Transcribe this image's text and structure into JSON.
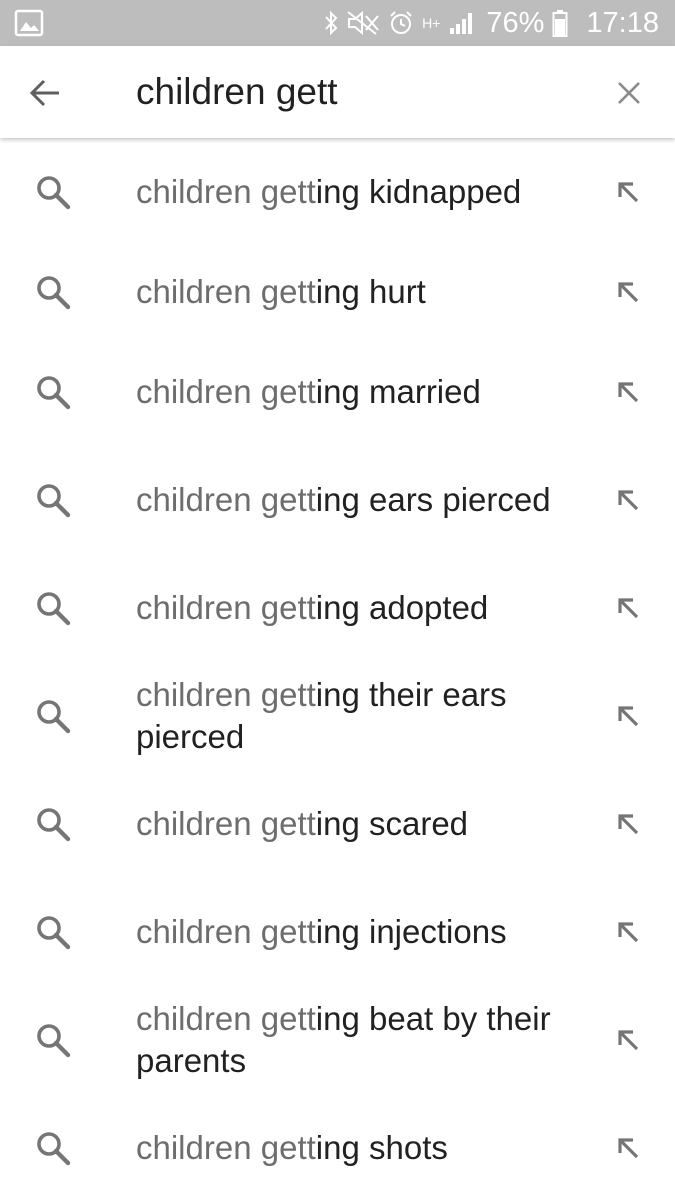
{
  "status_bar": {
    "icons": [
      "gallery-notification-icon",
      "bluetooth-icon",
      "mute-icon",
      "alarm-icon",
      "data-icon",
      "signal-icon",
      "battery-icon"
    ],
    "data_label": "H+",
    "battery_percent": "76%",
    "battery_level": 0.76,
    "time": "17:18"
  },
  "search": {
    "query": "children gett",
    "back_icon": "arrow-back-icon",
    "clear_icon": "close-icon"
  },
  "suggestions": [
    {
      "typed": "children gett",
      "completion": "ing kidnapped"
    },
    {
      "typed": "children gett",
      "completion": "ing hurt"
    },
    {
      "typed": "children gett",
      "completion": "ing married"
    },
    {
      "typed": "children gett",
      "completion": "ing ears pierced"
    },
    {
      "typed": "children gett",
      "completion": "ing adopted"
    },
    {
      "typed": "children gett",
      "completion": "ing their ears pierced"
    },
    {
      "typed": "children gett",
      "completion": "ing scared"
    },
    {
      "typed": "children gett",
      "completion": "ing injections"
    },
    {
      "typed": "children gett",
      "completion": "ing beat by their parents"
    },
    {
      "typed": "children gett",
      "completion": "ing shots"
    }
  ],
  "suggestion_icons": {
    "leading": "search-icon",
    "trailing": "arrow-up-left-icon"
  },
  "colors": {
    "status_bar_bg": "#bdbdbd",
    "typed_text": "#6d6d6d",
    "completion_text": "#212121",
    "icon_gray": "#757575"
  }
}
